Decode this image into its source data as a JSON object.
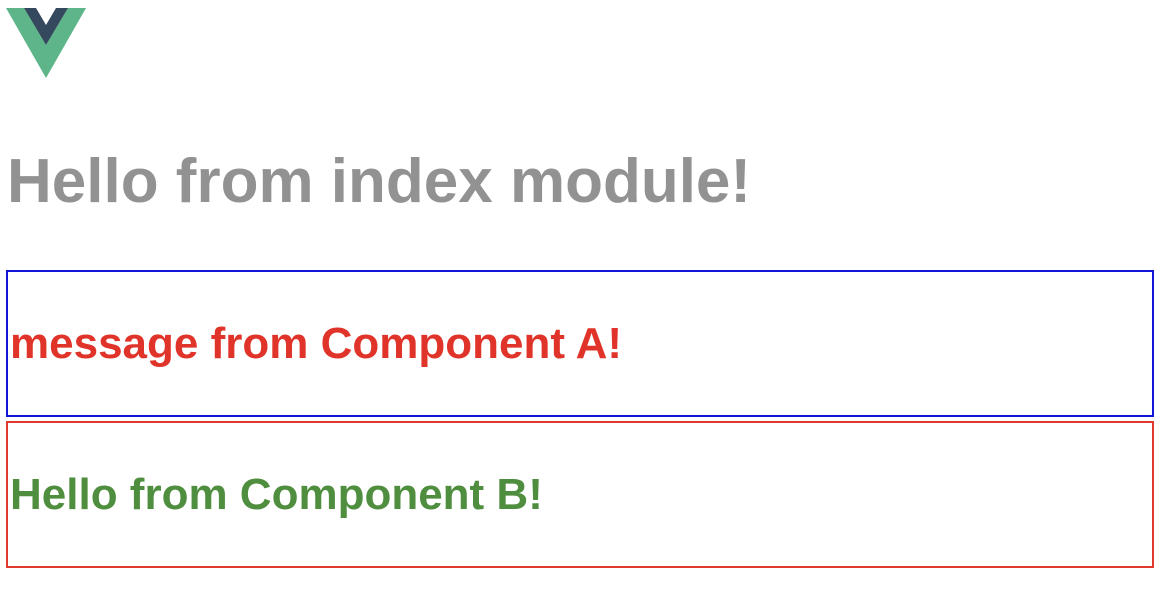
{
  "app": {
    "logo": "vue-logo",
    "title": "Hello from index module!"
  },
  "component_a": {
    "message": "message from Component A!"
  },
  "component_b": {
    "message": "Hello from Component B!"
  },
  "colors": {
    "title": "#929292",
    "component_a_border": "#1515d8",
    "component_a_text": "#e0342a",
    "component_b_border": "#e03a2e",
    "component_b_text": "#4e8e3e",
    "logo_green": "#5db589",
    "logo_dark": "#35495e"
  }
}
